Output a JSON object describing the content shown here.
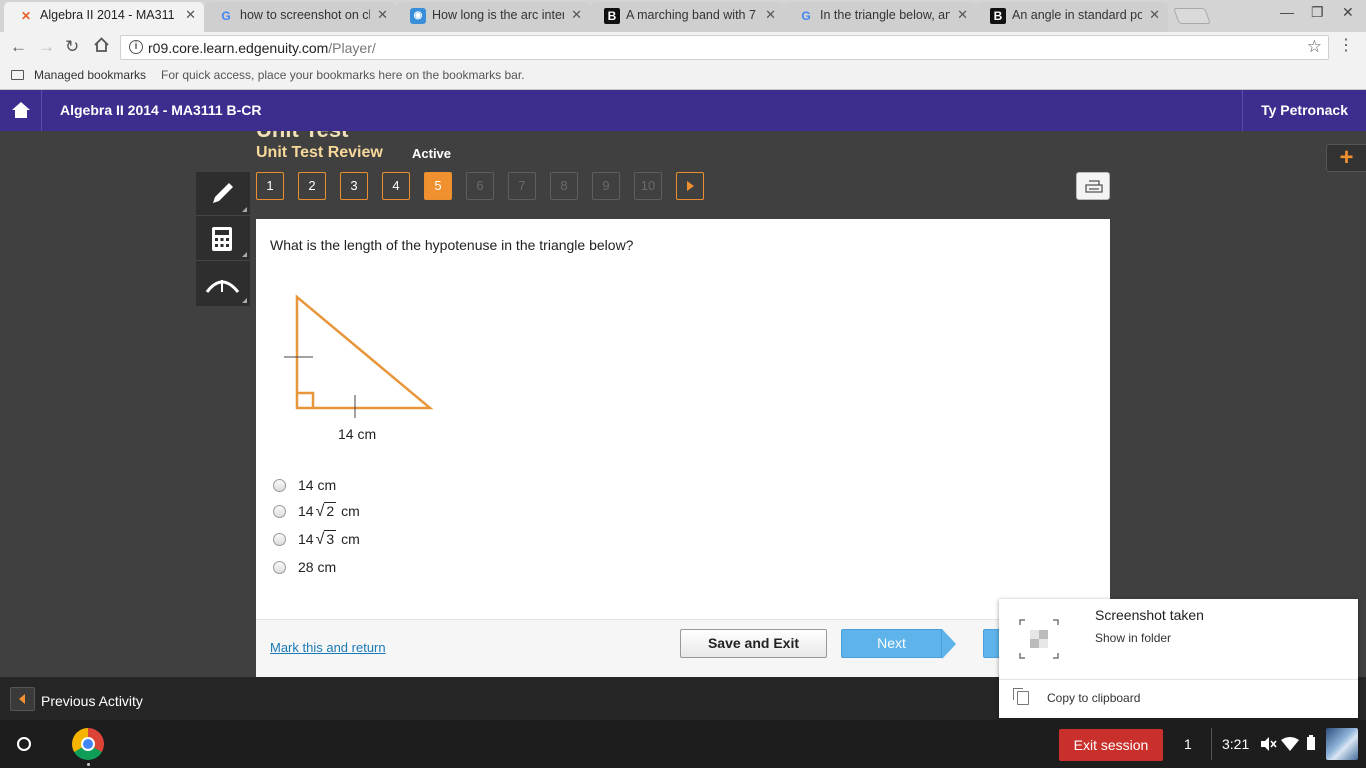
{
  "browser": {
    "tabs": [
      {
        "title": "Algebra II 2014 - MA311",
        "icon": "edgenuity-x-icon",
        "active": true
      },
      {
        "title": "how to screenshot on ch",
        "icon": "google-g-icon"
      },
      {
        "title": "How long is the arc inter",
        "icon": "brainly-icon"
      },
      {
        "title": "A marching band with 7",
        "icon": "b-icon"
      },
      {
        "title": "In the triangle below, and",
        "icon": "google-g-icon"
      },
      {
        "title": "An angle in standard po",
        "icon": "b-icon"
      }
    ],
    "url_host": "r09.core.learn.edgenuity.com",
    "url_path": "/Player/",
    "bookmarks": {
      "managed_label": "Managed bookmarks",
      "hint": "For quick access, place your bookmarks here on the bookmarks bar."
    }
  },
  "course": {
    "title": "Algebra II 2014 - MA3111 B-CR",
    "user": "Ty Petronack"
  },
  "player": {
    "section_partial": "Unit Test",
    "review_title": "Unit Test Review",
    "status": "Active",
    "question_numbers": [
      "1",
      "2",
      "3",
      "4",
      "5",
      "6",
      "7",
      "8",
      "9",
      "10"
    ],
    "current_question": 5,
    "plus_symbol": "+"
  },
  "question": {
    "prompt": "What is the length of the hypotenuse in the triangle below?",
    "leg_label": "14 cm",
    "choices": [
      {
        "text": "14 cm"
      },
      {
        "coef": "14",
        "radicand": "2",
        "unit": "cm"
      },
      {
        "coef": "14",
        "radicand": "3",
        "unit": "cm"
      },
      {
        "text": "28 cm"
      }
    ],
    "sqrt_symbol": "√"
  },
  "footer": {
    "mark_return": "Mark this and return",
    "save_exit": "Save and Exit",
    "next": "Next"
  },
  "activity_bar": {
    "previous_activity": "Previous Activity"
  },
  "notification": {
    "title": "Screenshot taken",
    "show_in_folder": "Show in folder",
    "copy_to_clipboard": "Copy to clipboard"
  },
  "shelf": {
    "exit_session": "Exit session",
    "session_count": "1",
    "time": "3:21"
  },
  "colors": {
    "header_purple": "#3d2d8e",
    "accent_orange": "#f0902e",
    "next_blue": "#5db3ea",
    "exit_red": "#c9302c"
  }
}
